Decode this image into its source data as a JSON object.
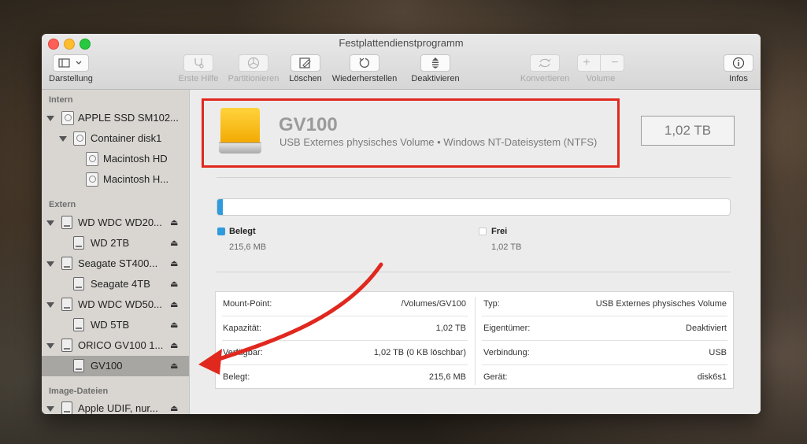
{
  "window": {
    "title": "Festplattendienstprogramm"
  },
  "toolbar": {
    "view": {
      "label": "Darstellung"
    },
    "first_aid": {
      "label": "Erste Hilfe"
    },
    "partition": {
      "label": "Partitionieren"
    },
    "erase": {
      "label": "Löschen"
    },
    "restore": {
      "label": "Wiederherstellen"
    },
    "unmount": {
      "label": "Deaktivieren"
    },
    "convert": {
      "label": "Konvertieren"
    },
    "volume": {
      "label": "Volume",
      "add": "+",
      "remove": "−"
    },
    "info": {
      "label": "Infos"
    }
  },
  "sidebar": {
    "sections": {
      "internal": "Intern",
      "external": "Extern",
      "images": "Image-Dateien"
    },
    "items": [
      {
        "label": "APPLE SSD SM102..."
      },
      {
        "label": "Container disk1"
      },
      {
        "label": "Macintosh HD"
      },
      {
        "label": "Macintosh H..."
      },
      {
        "label": "WD WDC WD20...",
        "eject": "⏏"
      },
      {
        "label": "WD 2TB",
        "eject": "⏏"
      },
      {
        "label": "Seagate ST400...",
        "eject": "⏏"
      },
      {
        "label": "Seagate 4TB",
        "eject": "⏏"
      },
      {
        "label": "WD WDC WD50...",
        "eject": "⏏"
      },
      {
        "label": "WD 5TB",
        "eject": "⏏"
      },
      {
        "label": "ORICO GV100 1...",
        "eject": "⏏"
      },
      {
        "label": "GV100",
        "eject": "⏏"
      },
      {
        "label": "Apple UDIF, nur...",
        "eject": "⏏"
      }
    ]
  },
  "volume": {
    "name": "GV100",
    "description": "USB Externes physisches Volume • Windows NT-Dateisystem (NTFS)",
    "capacity": "1,02 TB",
    "used_fraction": 0.0002
  },
  "legend": {
    "used": {
      "title": "Belegt",
      "value": "215,6 MB",
      "color": "#2f9bdc"
    },
    "free": {
      "title": "Frei",
      "value": "1,02 TB",
      "color": "#ffffff"
    }
  },
  "info": {
    "left": [
      {
        "key": "Mount-Point:",
        "value": "/Volumes/GV100"
      },
      {
        "key": "Kapazität:",
        "value": "1,02 TB"
      },
      {
        "key": "Verfügbar:",
        "value": "1,02 TB (0 KB löschbar)"
      },
      {
        "key": "Belegt:",
        "value": "215,6 MB"
      }
    ],
    "right": [
      {
        "key": "Typ:",
        "value": "USB Externes physisches Volume"
      },
      {
        "key": "Eigentümer:",
        "value": "Deaktiviert"
      },
      {
        "key": "Verbindung:",
        "value": "USB"
      },
      {
        "key": "Gerät:",
        "value": "disk6s1"
      }
    ]
  },
  "annotation": {
    "color": "#e0281f"
  }
}
